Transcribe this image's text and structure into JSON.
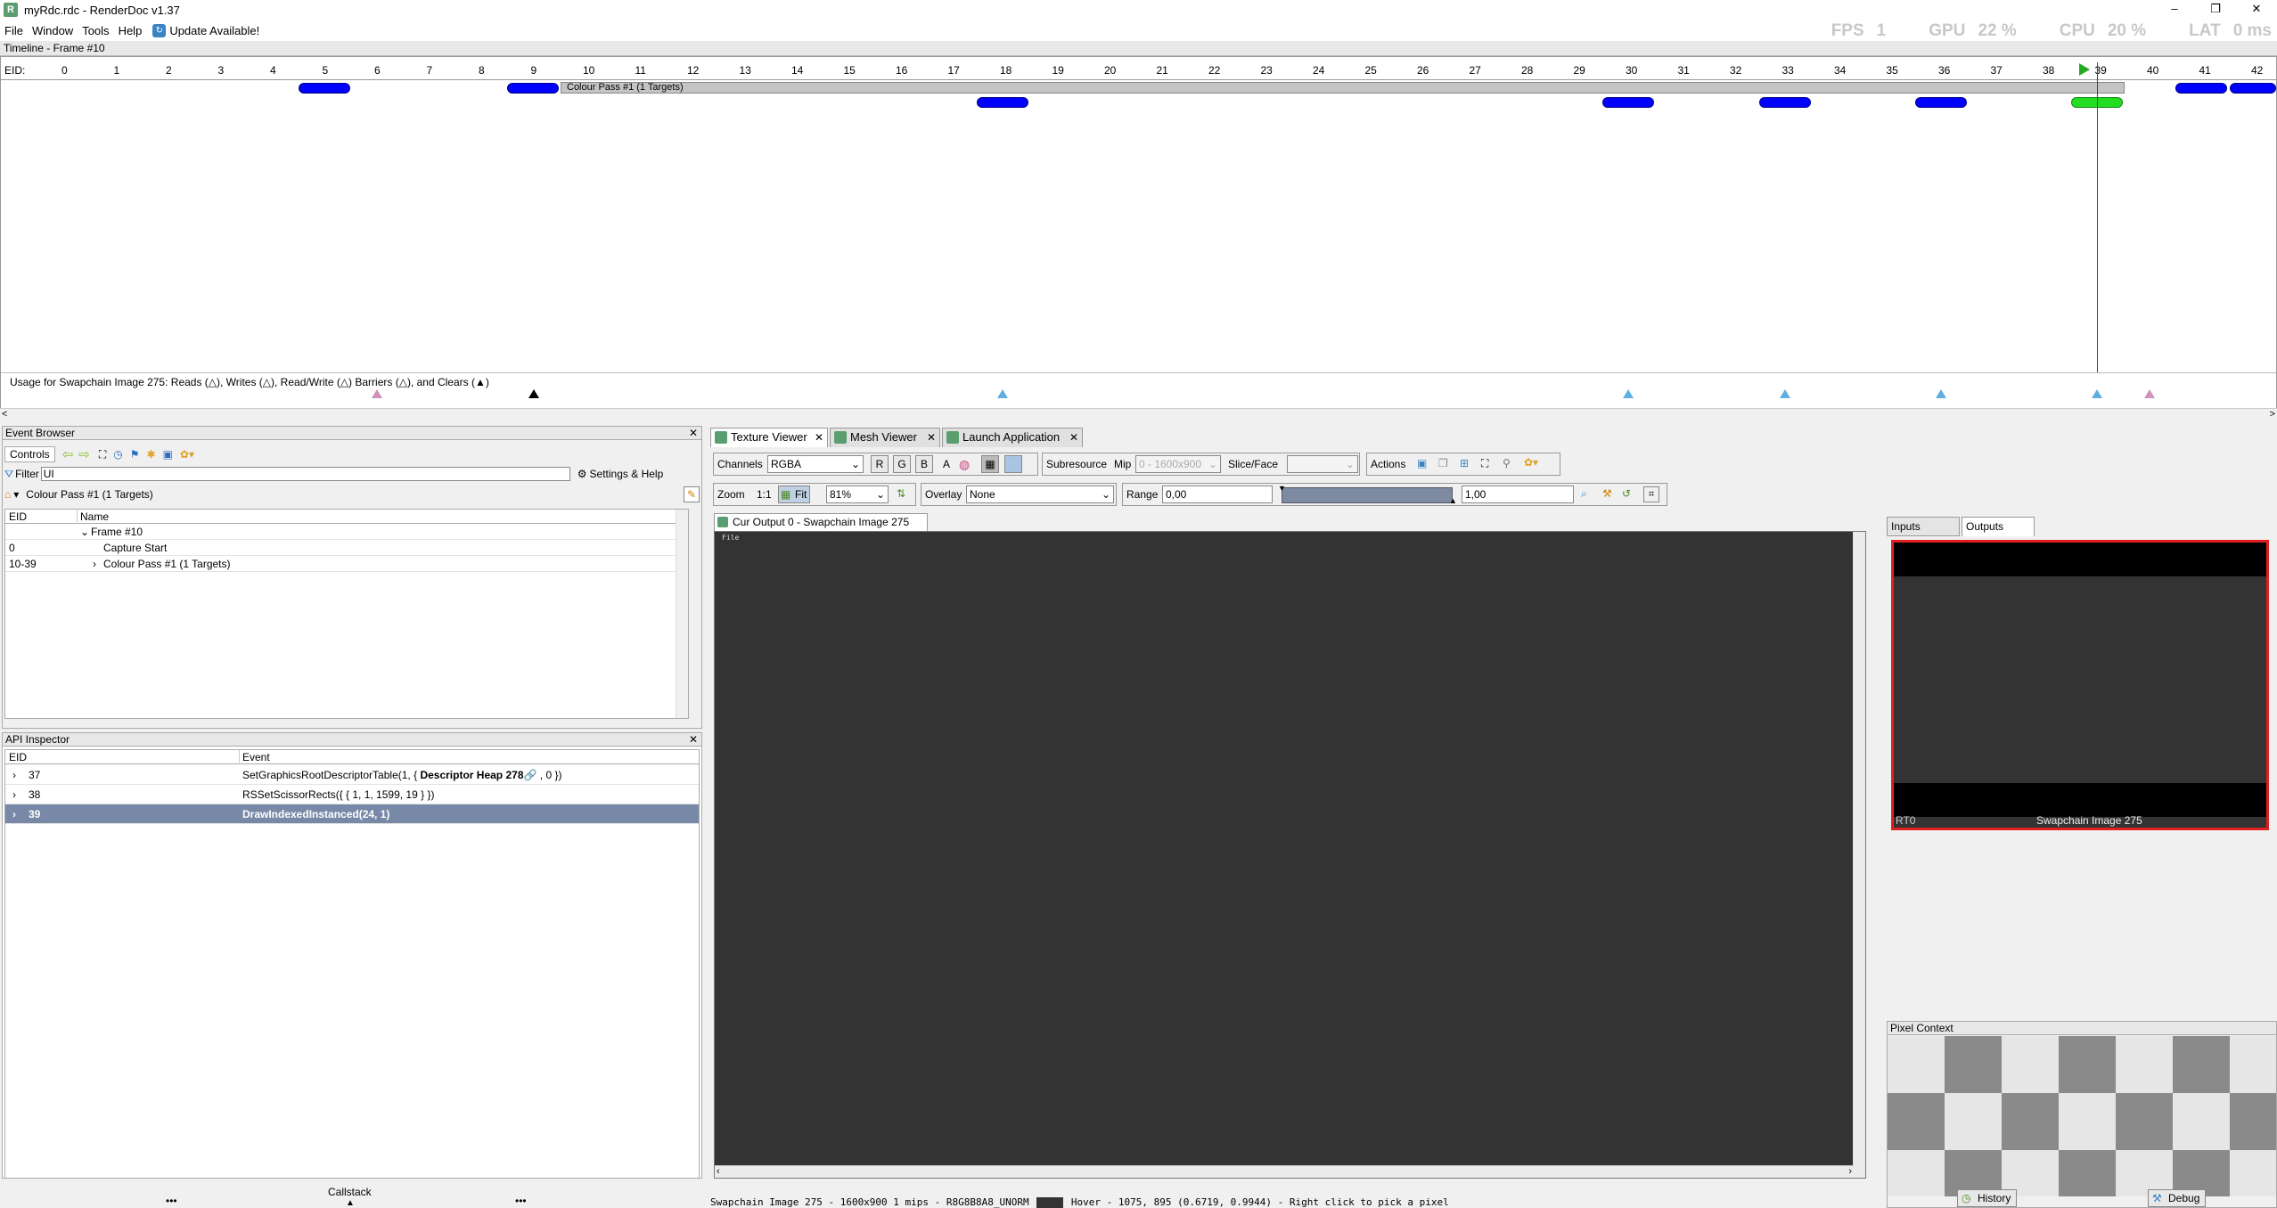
{
  "window": {
    "title": "myRdc.rdc - RenderDoc v1.37",
    "minimize": "–",
    "maximize": "❐",
    "close": "✕"
  },
  "menu": {
    "items": [
      "File",
      "Window",
      "Tools",
      "Help"
    ],
    "update": "Update Available!"
  },
  "stats": [
    {
      "label": "FPS",
      "value": "1"
    },
    {
      "label": "GPU",
      "value": "22 %"
    },
    {
      "label": "CPU",
      "value": "20 %"
    },
    {
      "label": "LAT",
      "value": "0 ms"
    }
  ],
  "timeline": {
    "header": "Timeline - Frame #10",
    "eid_label": "EID:",
    "ticks": [
      "0",
      "1",
      "2",
      "3",
      "4",
      "5",
      "6",
      "7",
      "8",
      "9",
      "10",
      "11",
      "12",
      "13",
      "14",
      "15",
      "16",
      "17",
      "18",
      "19",
      "20",
      "21",
      "22",
      "23",
      "24",
      "25",
      "26",
      "27",
      "28",
      "29",
      "30",
      "31",
      "32",
      "33",
      "34",
      "35",
      "36",
      "37",
      "38",
      "39",
      "40",
      "41",
      "42"
    ],
    "pass_label": "Colour Pass #1 (1 Targets)",
    "usage_label": "Usage for Swapchain Image 275: Reads (△), Writes (△), Read/Write (△) Barriers (△), and Clears (▲)",
    "scroll_left": "<",
    "scroll_right": ">"
  },
  "event_browser": {
    "title": "Event Browser",
    "controls_label": "Controls",
    "filter_label": "Filter",
    "filter_value": "UI",
    "settings_label": "Settings & Help",
    "breadcrumb": "Colour Pass #1 (1 Targets)",
    "col_eid": "EID",
    "col_name": "Name",
    "rows": [
      {
        "eid": "",
        "name": "Frame #10"
      },
      {
        "eid": "0",
        "name": "Capture Start"
      },
      {
        "eid": "10-39",
        "name": "Colour Pass #1 (1 Targets)"
      }
    ],
    "callstack": "Callstack",
    "dots": "•••"
  },
  "api_inspector": {
    "title": "API Inspector",
    "col_eid": "EID",
    "col_event": "Event",
    "rows": [
      {
        "eid": "37",
        "event_a": "SetGraphicsRootDescriptorTable(1, { ",
        "event_b": "Descriptor Heap 278",
        "event_c": " , 0 })"
      },
      {
        "eid": "38",
        "event_a": "RSSetScissorRects({ { 1, 1, 1599, 19 } })",
        "event_b": "",
        "event_c": ""
      },
      {
        "eid": "39",
        "event_a": "DrawIndexedInstanced(24, 1)",
        "event_b": "",
        "event_c": ""
      }
    ]
  },
  "texture_viewer": {
    "tabs": [
      "Texture Viewer",
      "Mesh Viewer",
      "Launch Application"
    ],
    "channels_label": "Channels",
    "channels_value": "RGBA",
    "r": "R",
    "g": "G",
    "b": "B",
    "a": "A",
    "subresource_label": "Subresource",
    "mip_label": "Mip",
    "mip_value": "0 - 1600x900",
    "slice_label": "Slice/Face",
    "actions_label": "Actions",
    "zoom_label": "Zoom",
    "zoom_1to1": "1:1",
    "fit_label": "Fit",
    "zoom_value": "81%",
    "overlay_label": "Overlay",
    "overlay_value": "None",
    "range_label": "Range",
    "range_min": "0,00",
    "range_max": "1,00",
    "output_tab": "Cur Output 0 - Swapchain Image 275",
    "canvas_text": "File",
    "status": "Swapchain Image 275 - 1600x900 1 mips - R8G8B8A8_UNORM",
    "status_hover": "Hover -  1075,  895 (0.6719, 0.9944)  - Right click to pick a pixel",
    "inputs_tab": "Inputs",
    "outputs_tab": "Outputs",
    "thumb_rt": "RT0",
    "thumb_name": "Swapchain Image 275",
    "pixel_context": "Pixel Context",
    "history": "History",
    "debug": "Debug"
  },
  "colors": {
    "marker": "#0000ff",
    "selected_marker": "#22cc22",
    "selection_row": "#7889a8",
    "thumb_border": "#e02020"
  }
}
